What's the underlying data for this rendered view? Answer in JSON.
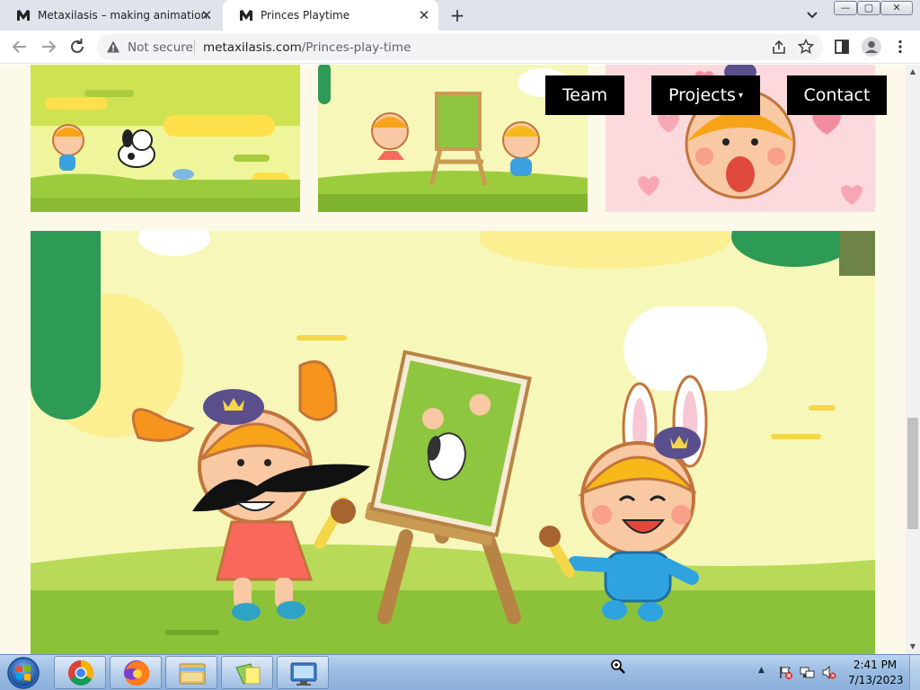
{
  "browser": {
    "tabs": [
      {
        "title": "Metaxilasis – making animation.",
        "active": false
      },
      {
        "title": "Princes Playtime",
        "active": true
      }
    ],
    "new_tab_label": "+",
    "security_label": "Not secure",
    "url_host": "metaxilasis.com",
    "url_path": "/Princes-play-time",
    "window_controls": {
      "minimize": "—",
      "maximize": "▢",
      "close": "✕"
    },
    "close_glyph": "✕"
  },
  "site": {
    "nav": [
      {
        "label": "Team"
      },
      {
        "label": "Projects",
        "caret": "▾"
      },
      {
        "label": "Contact"
      }
    ],
    "gallery": {
      "thumbnails": [
        {
          "subject": "girl-and-dog-running"
        },
        {
          "subject": "kids-painting-at-easel"
        },
        {
          "subject": "surprised-girl-with-hearts"
        }
      ],
      "hero": {
        "subject": "kids-painting-at-easel-large"
      }
    }
  },
  "scrollbar": {
    "up": "▲",
    "down": "▼",
    "position": 0.6
  },
  "taskbar": {
    "apps": [
      "chrome-icon",
      "firefox-icon",
      "explorer-icon",
      "files-icon",
      "remote-desktop-icon"
    ],
    "tray_arrow": "▲",
    "clock_time": "2:41 PM",
    "clock_date": "7/13/2023"
  },
  "colors": {
    "page_bg": "#fdf9e8",
    "nav_bg": "#000000",
    "nav_text": "#ffffff",
    "tab_strip": "#dfe3eb",
    "taskbar": "#9cbde2"
  }
}
